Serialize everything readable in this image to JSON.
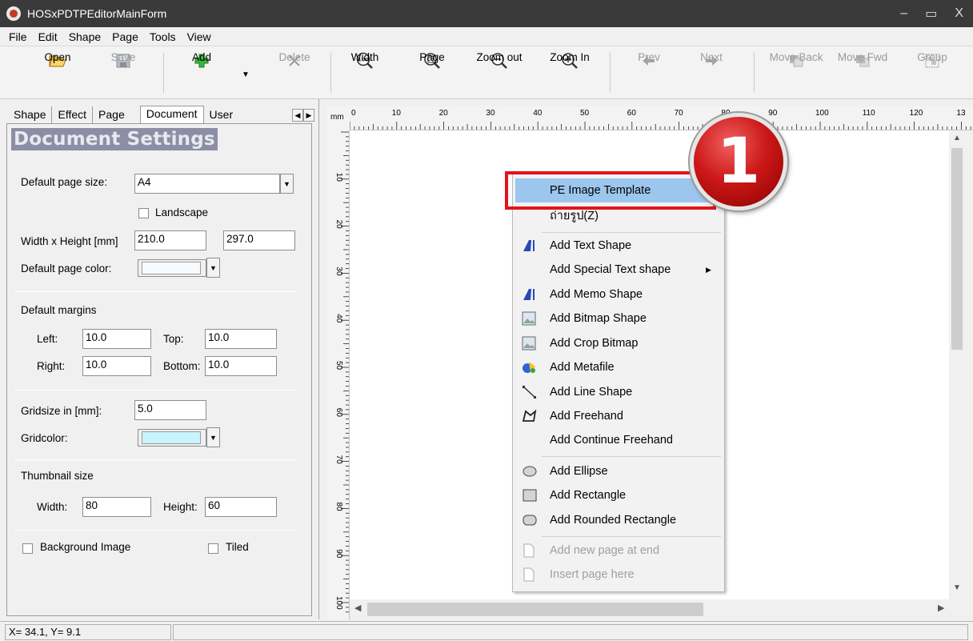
{
  "window": {
    "title": "HOSxPDTPEditorMainForm",
    "minimize": "‒",
    "maximize": "▭",
    "close": "X"
  },
  "menu": [
    "File",
    "Edit",
    "Shape",
    "Page",
    "Tools",
    "View"
  ],
  "toolbar": {
    "open": "Open",
    "save": "Save",
    "add": "Add",
    "delete": "Delete",
    "width": "Width",
    "page": "Page",
    "zoom_out": "Zoom out",
    "zoom_in": "Zoom In",
    "prev": "Prev",
    "next": "Next",
    "move_back": "Move Back",
    "move_fwd": "Move Fwd",
    "group": "Group"
  },
  "tabs": [
    "Shape",
    "Effect",
    "Page",
    "Document",
    "User"
  ],
  "document": {
    "title": "Document Settings",
    "page_size_label": "Default page size:",
    "page_size_value": "A4",
    "landscape_label": "Landscape",
    "wh_label": "Width x Height [mm]",
    "width_value": "210.0",
    "height_value": "297.0",
    "page_color_label": "Default page color:",
    "page_color": "#f7fbff",
    "margins_label": "Default margins",
    "left_label": "Left:",
    "left_value": "10.0",
    "top_label": "Top:",
    "top_value": "10.0",
    "right_label": "Right:",
    "right_value": "10.0",
    "bottom_label": "Bottom:",
    "bottom_value": "10.0",
    "gridsize_label": "Gridsize in [mm]:",
    "gridsize_value": "5.0",
    "gridcolor_label": "Gridcolor:",
    "gridcolor": "#c8f4ff",
    "thumb_label": "Thumbnail size",
    "thumb_width_label": "Width:",
    "thumb_width_value": "80",
    "thumb_height_label": "Height:",
    "thumb_height_value": "60",
    "bg_image_label": "Background Image",
    "tiled_label": "Tiled"
  },
  "ruler": {
    "unit": "mm",
    "h_labels": [
      "0",
      "10",
      "20",
      "30",
      "40",
      "50",
      "60",
      "70",
      "80",
      "90",
      "100",
      "110",
      "120",
      "13"
    ],
    "v_labels": [
      "10",
      "20",
      "30",
      "40",
      "50",
      "60",
      "70",
      "80",
      "90",
      "100"
    ]
  },
  "context_menu": {
    "items": [
      {
        "label": "PE Image Template",
        "icon": ""
      },
      {
        "label": "ถ่ายรูป(Z)",
        "icon": ""
      },
      {
        "label": "Add Text Shape",
        "icon": "text-shape-icon"
      },
      {
        "label": "Add Special Text shape",
        "icon": ""
      },
      {
        "label": "Add Memo Shape",
        "icon": "memo-shape-icon"
      },
      {
        "label": "Add Bitmap Shape",
        "icon": "bitmap-icon"
      },
      {
        "label": "Add Crop Bitmap",
        "icon": "crop-bitmap-icon"
      },
      {
        "label": "Add Metafile",
        "icon": "metafile-icon"
      },
      {
        "label": "Add Line Shape",
        "icon": "line-shape-icon"
      },
      {
        "label": "Add Freehand",
        "icon": "freehand-icon"
      },
      {
        "label": "Add Continue Freehand",
        "icon": ""
      },
      {
        "label": "Add Ellipse",
        "icon": "ellipse-icon"
      },
      {
        "label": "Add Rectangle",
        "icon": "rectangle-icon"
      },
      {
        "label": "Add Rounded Rectangle",
        "icon": "rounded-rectangle-icon"
      },
      {
        "label": "Add new page at end",
        "icon": "page-icon"
      },
      {
        "label": "Insert page here",
        "icon": "page-icon"
      }
    ]
  },
  "callout": "1",
  "status": {
    "coords": "X=  34.1, Y=   9.1"
  },
  "colors": {
    "highlight": "#9cc6ee",
    "callout_red": "#cc1818",
    "annotation_box": "#e3141b"
  }
}
